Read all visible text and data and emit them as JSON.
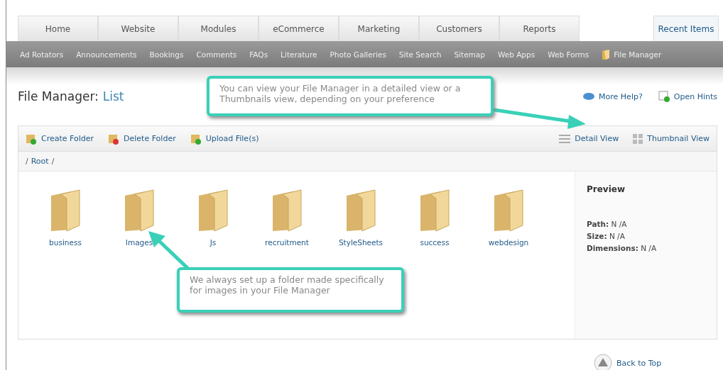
{
  "tabs": [
    {
      "label": "Home"
    },
    {
      "label": "Website"
    },
    {
      "label": "Modules"
    },
    {
      "label": "eCommerce"
    },
    {
      "label": "Marketing"
    },
    {
      "label": "Customers"
    },
    {
      "label": "Reports"
    }
  ],
  "recent_items": "Recent Items",
  "subnav": [
    {
      "label": "Ad Rotators",
      "selected": false
    },
    {
      "label": "Announcements",
      "selected": false
    },
    {
      "label": "Bookings",
      "selected": false
    },
    {
      "label": "Comments",
      "selected": false
    },
    {
      "label": "FAQs",
      "selected": false
    },
    {
      "label": "Literature",
      "selected": false
    },
    {
      "label": "Photo Galleries",
      "selected": false
    },
    {
      "label": "Site Search",
      "selected": false
    },
    {
      "label": "Sitemap",
      "selected": false
    },
    {
      "label": "Web Apps",
      "selected": false
    },
    {
      "label": "Web Forms",
      "selected": false
    },
    {
      "label": "File Manager",
      "selected": true
    }
  ],
  "page_title": {
    "prefix": "File Manager:",
    "name": "List"
  },
  "help_links": [
    "More Help?",
    "Open Hints"
  ],
  "toolbar": {
    "actions": [
      {
        "label": "Create Folder",
        "kind": "create"
      },
      {
        "label": "Delete Folder",
        "kind": "delete"
      },
      {
        "label": "Upload File(s)",
        "kind": "upload"
      }
    ],
    "views": [
      {
        "label": "Detail View",
        "kind": "detail"
      },
      {
        "label": "Thumbnail View",
        "kind": "thumbnail"
      }
    ]
  },
  "breadcrumb": [
    "/",
    "Root",
    "/"
  ],
  "folders": [
    "business",
    "Images",
    "Js",
    "recruitment",
    "StyleSheets",
    "success",
    "webdesign"
  ],
  "preview": {
    "title": "Preview",
    "lines": [
      "**Path:** N /A",
      "**Size:** N /A",
      "**Dimensions:** N /A"
    ]
  },
  "callouts": [
    "You can view your File Manager in a detailed view or a Thumbnails view, depending on your preference",
    "We always set up a folder made specifically for images in your File Manager"
  ],
  "back_to_top": "Back to Top"
}
